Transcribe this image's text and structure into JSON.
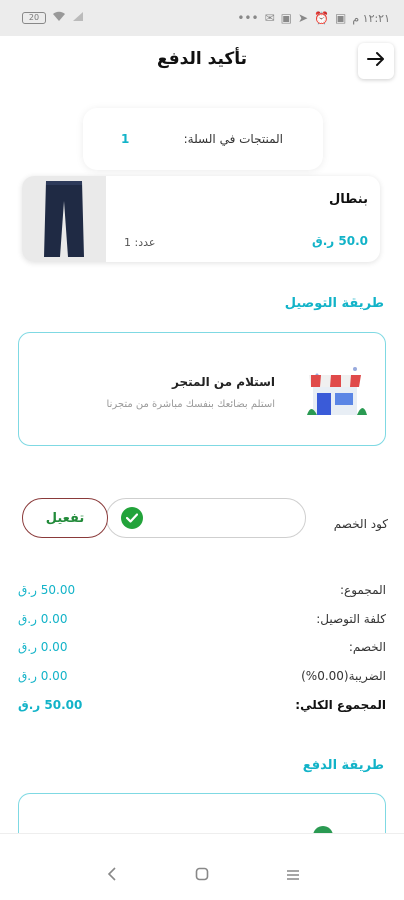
{
  "status_bar": {
    "battery": "20",
    "left_icons": [
      "battery-icon",
      "wifi-icon",
      "signal-icon"
    ],
    "time": "١٢:٢١ م",
    "right_icons": [
      "dots-icon",
      "mail-icon",
      "image-icon",
      "telegram-icon",
      "alarm-icon",
      "image-icon"
    ]
  },
  "header": {
    "title": "تأكيد الدفع",
    "back_icon": "arrow-right-icon"
  },
  "cart": {
    "label": "المنتجات في السلة:",
    "count": "1"
  },
  "product": {
    "name": "بنطال",
    "price": "50.0 ر.ق",
    "qty": "عدد: 1",
    "image": "pants-image"
  },
  "delivery": {
    "section_title": "طريقة التوصيل",
    "option_title": "استلام من المتجر",
    "option_desc": "استلم بضائعك بنفسك مباشرة من متجرنا",
    "icon": "store-icon"
  },
  "coupon": {
    "label": "كود الخصم",
    "value": "",
    "activate": "تفعيل",
    "icon": "check-circle-icon",
    "check_color": "#22a33a"
  },
  "summary": [
    {
      "label": "المجموع:",
      "value": "50.00 ر.ق"
    },
    {
      "label": "كلفة التوصيل:",
      "value": "0.00 ر.ق"
    },
    {
      "label": "الخصم:",
      "value": "0.00 ر.ق"
    },
    {
      "label": "الضريبة(0.00%)",
      "value": "0.00 ر.ق"
    },
    {
      "label": "المجموع الكلي:",
      "value": "50.00 ر.ق"
    }
  ],
  "payment": {
    "section_title": "طريقة الدفع"
  },
  "nav": {
    "back": "back-icon",
    "home": "home-icon",
    "menu": "menu-icon"
  },
  "colors": {
    "accent": "#12b3c8",
    "border": "#7fd9e3",
    "success": "#22a33a",
    "activate_border": "#8a3a3a"
  }
}
